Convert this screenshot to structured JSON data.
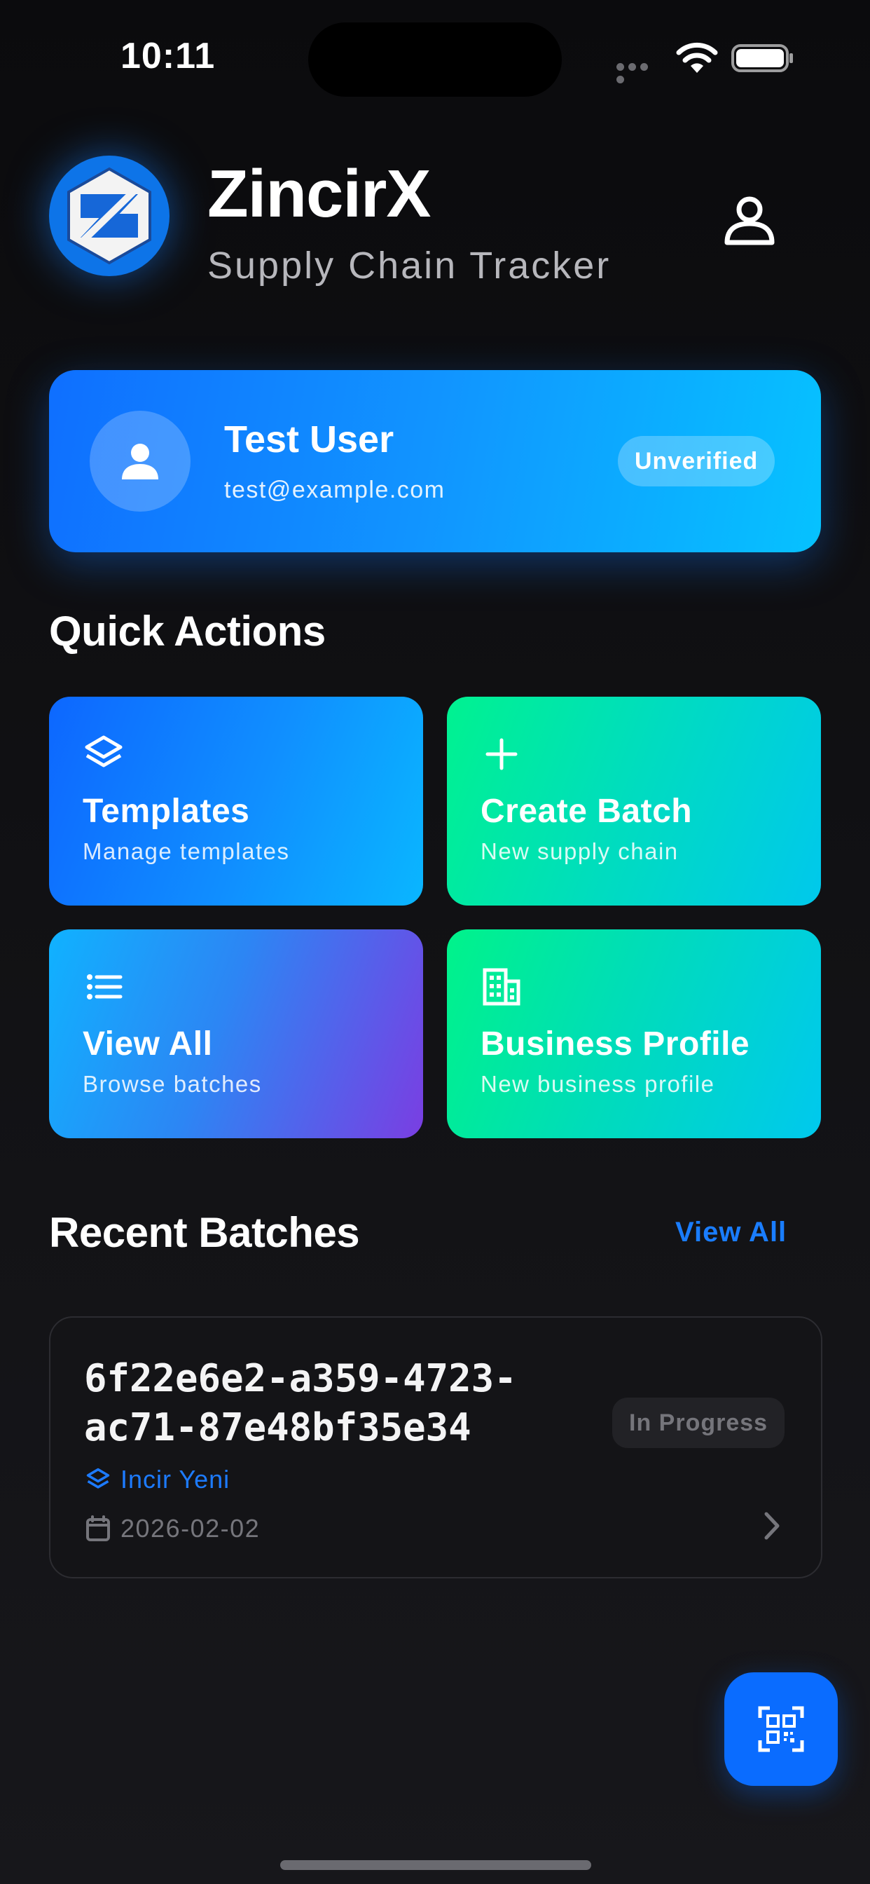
{
  "status_bar": {
    "time": "10:11"
  },
  "header": {
    "title": "ZincirX",
    "subtitle": "Supply Chain Tracker",
    "logo_icon": "zincirx-logo",
    "profile_icon": "user-outline-icon"
  },
  "user_card": {
    "name": "Test User",
    "email": "test@example.com",
    "status": "Unverified",
    "avatar_icon": "user-filled-icon"
  },
  "quick_actions": {
    "title": "Quick Actions",
    "items": [
      {
        "title": "Templates",
        "subtitle": "Manage templates",
        "icon": "layers-icon"
      },
      {
        "title": "Create Batch",
        "subtitle": "New supply chain",
        "icon": "plus-icon"
      },
      {
        "title": "View All",
        "subtitle": "Browse batches",
        "icon": "list-icon"
      },
      {
        "title": "Business Profile",
        "subtitle": "New business profile",
        "icon": "building-icon"
      }
    ]
  },
  "recent_batches": {
    "title": "Recent Batches",
    "view_all_label": "View All",
    "items": [
      {
        "id_line1": "6f22e6e2-a359-4723-",
        "id_line2": "ac71-87e48bf35e34",
        "status": "In Progress",
        "template": "Incir Yeni",
        "date": "2026-02-02"
      }
    ]
  },
  "fab": {
    "icon": "qr-scan-icon"
  },
  "colors": {
    "background": "#0c0c0e",
    "accent_blue": "#1a7dff",
    "accent_green": "#00e6a8",
    "muted_text": "#76767c"
  }
}
